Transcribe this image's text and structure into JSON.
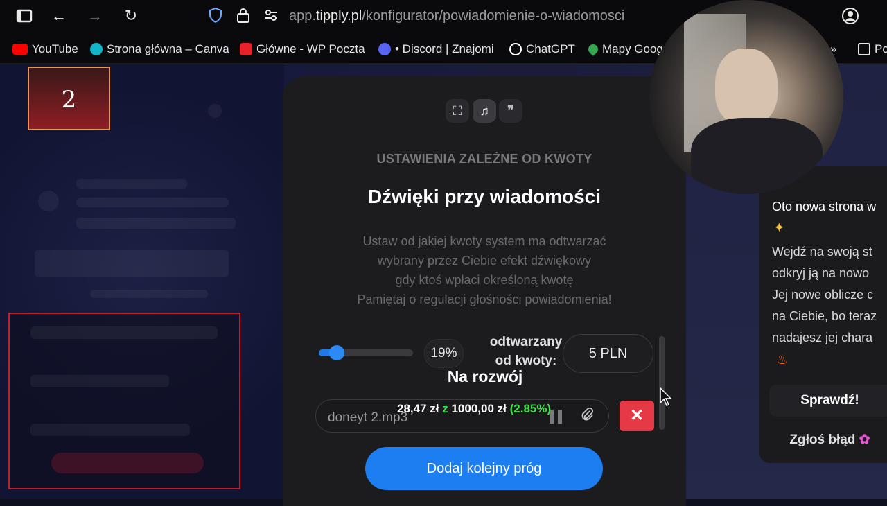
{
  "browser": {
    "url_prefix": "app.",
    "url_domain": "tipply.pl",
    "url_path": "/konfigurator/powiadomienie-o-wiadomosci",
    "bookmarks": [
      {
        "label": "YouTube",
        "color": "#ff0000"
      },
      {
        "label": "Strona główna – Canva",
        "color": "#13b5c8"
      },
      {
        "label": "Główne - WP Poczta",
        "color": "#e8222b"
      },
      {
        "label": "• Discord | Znajomi",
        "color": "#5865f2"
      },
      {
        "label": "ChatGPT",
        "color": "#ffffff"
      },
      {
        "label": "Mapy Goog",
        "color": "#34a853"
      },
      {
        "label": "Po",
        "color": "#e6e6e6"
      }
    ]
  },
  "overlay": {
    "badge_number": "2"
  },
  "panel": {
    "subheading": "USTAWIENIA ZALEŻNE OD KWOTY",
    "title": "Dźwięki przy wiadomości",
    "description": [
      "Ustaw od jakiej kwoty system ma odtwarzać",
      "wybrany przez Ciebie efekt dźwiękowy",
      "gdy ktoś wpłaci określoną kwotę",
      "Pamiętaj o regulacji głośności powiadomienia!"
    ],
    "volume_percent": 19,
    "volume_label": "19%",
    "played_from_label": "odtwarzany od kwoty:",
    "amount_value": "5 PLN",
    "file_name": "doneyt 2.mp3",
    "add_button": "Dodaj kolejny próg"
  },
  "goal_overlay": {
    "title": "Na rozwój",
    "current": "28,47 zł",
    "sep": "z",
    "target": "1000,00 zł",
    "percent": "(2.85%)"
  },
  "popup": {
    "title": "Oto nowa strona w",
    "lines": [
      "Wejdź na swoją st",
      "odkryj ją na nowo",
      "Jej nowe oblicze c",
      "na Ciebie, bo teraz",
      "nadajesz jej chara"
    ],
    "check_button": "Sprawdź!",
    "report_button": "Zgłoś błąd"
  },
  "colors": {
    "accent": "#1c7ef0",
    "danger": "#e63946",
    "goal_green": "#2ee84b"
  }
}
